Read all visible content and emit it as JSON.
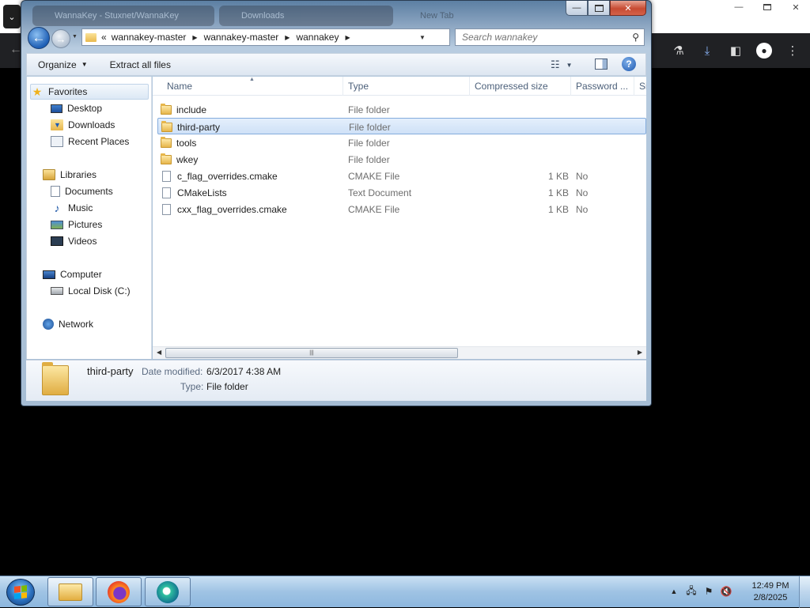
{
  "browser": {
    "menu_icon": "chevron-down-icon",
    "back_icon": "back-arrow-icon",
    "toolbar_icons": [
      "flask-icon",
      "download-icon",
      "sidebar-icon",
      "profile-icon",
      "more-vert-icon"
    ],
    "accent": "#8ab4f8"
  },
  "explorer": {
    "faded_tabs": [
      "WannaKey - Stuxnet/WannaKey",
      "Downloads",
      "New Tab"
    ],
    "caption": {
      "minimize": "—",
      "maximize": "□",
      "close": "✕"
    },
    "address": {
      "overflow": "«",
      "crumbs": [
        "wannakey-master",
        "wannakey-master",
        "wannakey"
      ]
    },
    "search": {
      "placeholder": "Search wannakey"
    },
    "commands": {
      "organize": "Organize",
      "extract": "Extract all files"
    },
    "nav": {
      "favorites": {
        "label": "Favorites",
        "items": [
          "Desktop",
          "Downloads",
          "Recent Places"
        ]
      },
      "libraries": {
        "label": "Libraries",
        "items": [
          "Documents",
          "Music",
          "Pictures",
          "Videos"
        ]
      },
      "computer": {
        "label": "Computer",
        "items": [
          "Local Disk (C:)"
        ]
      },
      "network": {
        "label": "Network"
      }
    },
    "columns": {
      "name": "Name",
      "type": "Type",
      "compressed": "Compressed size",
      "password": "Password ...",
      "size": "Si"
    },
    "files": [
      {
        "name": "include",
        "type": "File folder",
        "size": "",
        "password": "",
        "kind": "folder"
      },
      {
        "name": "third-party",
        "type": "File folder",
        "size": "",
        "password": "",
        "kind": "folder",
        "selected": true
      },
      {
        "name": "tools",
        "type": "File folder",
        "size": "",
        "password": "",
        "kind": "folder"
      },
      {
        "name": "wkey",
        "type": "File folder",
        "size": "",
        "password": "",
        "kind": "folder"
      },
      {
        "name": "c_flag_overrides.cmake",
        "type": "CMAKE File",
        "size": "1 KB",
        "password": "No",
        "kind": "file"
      },
      {
        "name": "CMakeLists",
        "type": "Text Document",
        "size": "1 KB",
        "password": "No",
        "kind": "file"
      },
      {
        "name": "cxx_flag_overrides.cmake",
        "type": "CMAKE File",
        "size": "1 KB",
        "password": "No",
        "kind": "file"
      }
    ],
    "details": {
      "name": "third-party",
      "date_label": "Date modified:",
      "date_value": "6/3/2017 4:38 AM",
      "type_label": "Type:",
      "type_value": "File folder"
    }
  },
  "taskbar": {
    "clock_time": "12:49 PM",
    "clock_date": "2/8/2025",
    "tray_icons": [
      "show-hidden-icons",
      "network-icon",
      "action-center-flag-icon",
      "volume-muted-icon"
    ],
    "apps": [
      "windows-explorer-icon",
      "firefox-icon",
      "edge-icon"
    ]
  }
}
